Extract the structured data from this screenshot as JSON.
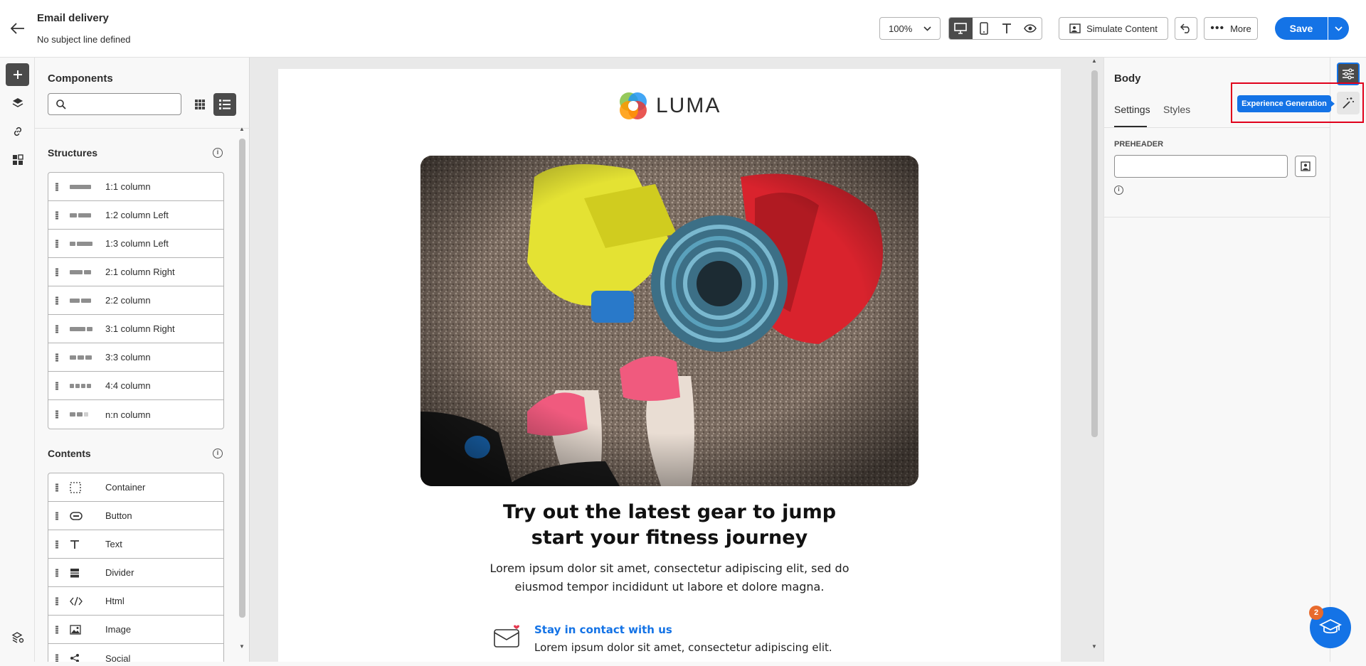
{
  "header": {
    "title": "Email delivery",
    "subtitle": "No subject line defined",
    "zoom": "100%",
    "simulate_label": "Simulate Content",
    "more_label": "More",
    "save_label": "Save"
  },
  "components": {
    "title": "Components",
    "structures_title": "Structures",
    "structures": [
      {
        "label": "1:1 column",
        "icon": "structure-1-1-icon"
      },
      {
        "label": "1:2 column Left",
        "icon": "structure-1-2-left-icon"
      },
      {
        "label": "1:3 column Left",
        "icon": "structure-1-3-left-icon"
      },
      {
        "label": "2:1 column Right",
        "icon": "structure-2-1-right-icon"
      },
      {
        "label": "2:2 column",
        "icon": "structure-2-2-icon"
      },
      {
        "label": "3:1 column Right",
        "icon": "structure-3-1-right-icon"
      },
      {
        "label": "3:3 column",
        "icon": "structure-3-3-icon"
      },
      {
        "label": "4:4 column",
        "icon": "structure-4-4-icon"
      },
      {
        "label": "n:n column",
        "icon": "structure-n-n-icon"
      }
    ],
    "contents_title": "Contents",
    "contents": [
      {
        "label": "Container",
        "icon": "container-icon"
      },
      {
        "label": "Button",
        "icon": "button-icon"
      },
      {
        "label": "Text",
        "icon": "text-icon"
      },
      {
        "label": "Divider",
        "icon": "divider-icon"
      },
      {
        "label": "Html",
        "icon": "code-icon"
      },
      {
        "label": "Image",
        "icon": "image-icon"
      },
      {
        "label": "Social",
        "icon": "social-icon"
      }
    ]
  },
  "email": {
    "brand": "LUMA",
    "headline": "Try out the latest gear to jump start your fitness journey",
    "body": "Lorem ipsum dolor sit amet, consectetur adipiscing elit, sed do eiusmod tempor incididunt ut labore et dolore magna.",
    "contact_title": "Stay in contact with us",
    "contact_body": "Lorem ipsum dolor sit amet, consectetur adipiscing elit."
  },
  "properties": {
    "title": "Body",
    "tabs": [
      "Settings",
      "Styles"
    ],
    "active_tab": "Settings",
    "preheader_label": "PREHEADER",
    "preheader_value": "",
    "tooltip": "Experience Generation"
  },
  "help": {
    "badge": "2"
  },
  "colors": {
    "accent": "#1473e6",
    "highlight": "#e0001b"
  }
}
